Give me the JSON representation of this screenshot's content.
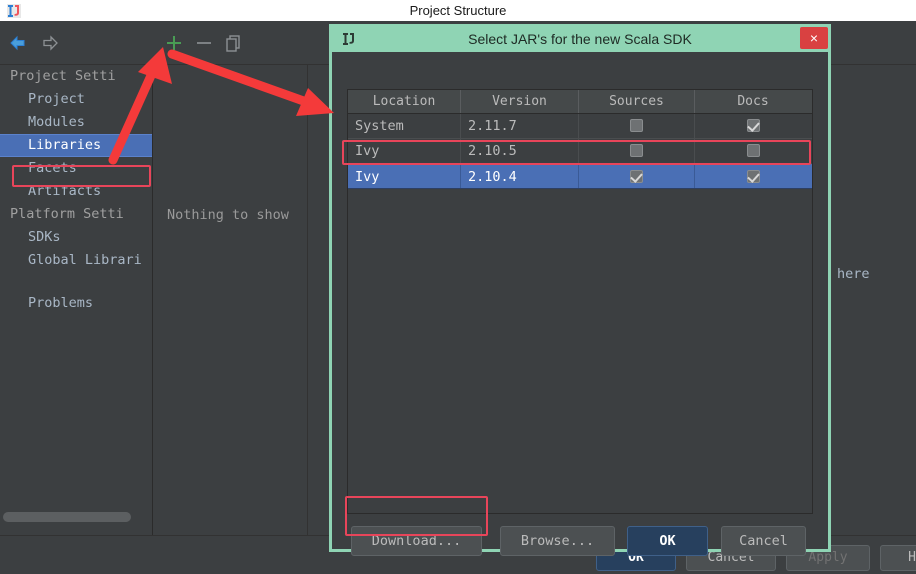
{
  "os_window": {
    "title": "Project Structure",
    "icon": "intellij-idea-logo-icon"
  },
  "sidebar": {
    "back_icon": "arrow-left-icon",
    "forward_icon": "arrow-right-icon",
    "items": [
      {
        "label": "Project Setti",
        "type": "group",
        "selected": false
      },
      {
        "label": "Project",
        "type": "child",
        "selected": false
      },
      {
        "label": "Modules",
        "type": "child",
        "selected": false
      },
      {
        "label": "Libraries",
        "type": "child",
        "selected": true
      },
      {
        "label": "Facets",
        "type": "child",
        "selected": false
      },
      {
        "label": "Artifacts",
        "type": "child",
        "selected": false
      },
      {
        "label": "Platform Setti",
        "type": "group",
        "selected": false
      },
      {
        "label": "SDKs",
        "type": "child",
        "selected": false
      },
      {
        "label": "Global Librari",
        "type": "child",
        "selected": false
      },
      {
        "label": "",
        "type": "spacer",
        "selected": false
      },
      {
        "label": "Problems",
        "type": "child",
        "selected": false
      }
    ],
    "scrollbar": "horizontal-scrollbar"
  },
  "center_panel": {
    "toolbar": {
      "add_icon": "plus-icon",
      "remove_icon": "minus-icon",
      "copy_icon": "copy-icon"
    },
    "empty_message": "Nothing to show",
    "right_text": "here"
  },
  "project_structure_buttons": {
    "ok": "OK",
    "cancel": "Cancel",
    "apply": "Apply",
    "help": "H"
  },
  "dialog": {
    "title": "Select JAR's for the new Scala SDK",
    "icon": "intellij-idea-logo-icon",
    "close_label": "×",
    "table": {
      "columns": [
        "Location",
        "Version",
        "Sources",
        "Docs"
      ],
      "rows": [
        {
          "location": "System",
          "version": "2.11.7",
          "sources": false,
          "docs": true,
          "selected": false
        },
        {
          "location": "Ivy",
          "version": "2.10.5",
          "sources": false,
          "docs": false,
          "selected": false
        },
        {
          "location": "Ivy",
          "version": "2.10.4",
          "sources": true,
          "docs": true,
          "selected": true
        }
      ]
    },
    "buttons": {
      "download": "Download...",
      "browse": "Browse...",
      "ok": "OK",
      "cancel": "Cancel"
    }
  },
  "annotations": {
    "accent_color": "#e8455a",
    "highlight_libraries": "red-rectangle-libraries",
    "highlight_selected_row": "red-rectangle-selected-row",
    "highlight_download": "red-rectangle-download-button",
    "arrow_to_plus": "red-arrow-up-right",
    "arrow_to_table": "red-arrow-down-right"
  },
  "colors": {
    "window_bg": "#3c3f41",
    "dialog_border": "#8fd4b4",
    "selection_blue": "#4a6fb5",
    "primary_button": "#27405e",
    "close_red": "#d94141",
    "plus_green": "#499c54"
  }
}
